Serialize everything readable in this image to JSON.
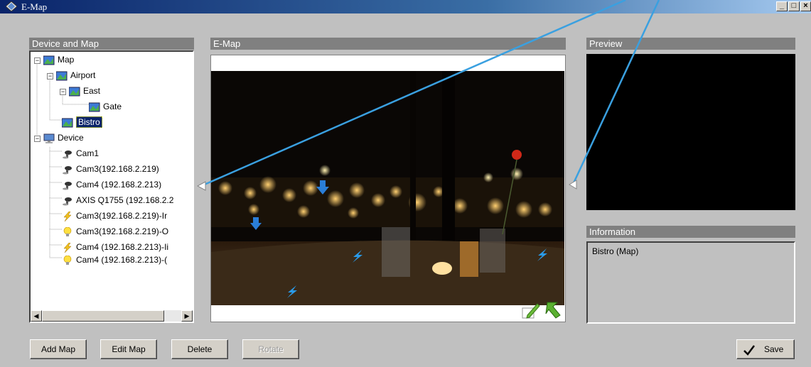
{
  "window": {
    "title": "E-Map",
    "controls": [
      "_",
      "□",
      "×"
    ]
  },
  "panels": {
    "device_map": "Device and Map",
    "emap": "E-Map",
    "preview": "Preview",
    "information": "Information"
  },
  "tree": {
    "map_root": "Map",
    "airport": "Airport",
    "east": "East",
    "gate": "Gate",
    "bistro": "Bistro",
    "device_root": "Device",
    "devices": [
      "Cam1",
      "Cam3(192.168.2.219)",
      "Cam4 (192.168.2.213)",
      "AXIS Q1755 (192.168.2.2",
      "Cam3(192.168.2.219)-Ir",
      "Cam3(192.168.2.219)-O",
      "Cam4 (192.168.2.213)-Ii",
      "Cam4 (192.168.2.213)-("
    ]
  },
  "information": {
    "text": "Bistro (Map)"
  },
  "buttons": {
    "add_map": "Add Map",
    "edit_map": "Edit Map",
    "delete": "Delete",
    "rotate": "Rotate",
    "save": "Save"
  },
  "colors": {
    "titlebar": "#0a246a",
    "panel_header": "#808080",
    "callout_line": "#3aa0e0",
    "selection": "#0a246a"
  }
}
